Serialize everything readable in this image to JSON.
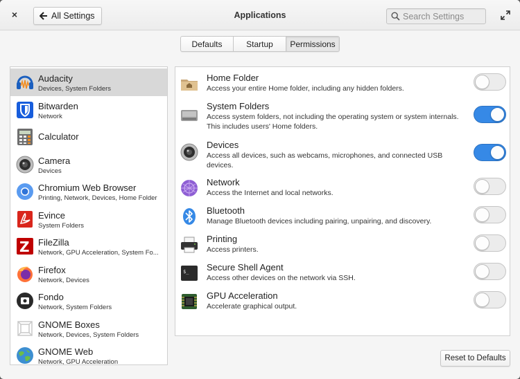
{
  "header": {
    "close_glyph": "×",
    "back_label": "All Settings",
    "title": "Applications",
    "search_placeholder": "Search Settings"
  },
  "modes": [
    {
      "label": "Defaults",
      "active": false
    },
    {
      "label": "Startup",
      "active": false
    },
    {
      "label": "Permissions",
      "active": true
    }
  ],
  "apps": [
    {
      "name": "Audacity",
      "perms": "Devices, System Folders",
      "icon": "audacity-icon",
      "selected": true
    },
    {
      "name": "Bitwarden",
      "perms": "Network",
      "icon": "bitwarden-icon"
    },
    {
      "name": "Calculator",
      "perms": "",
      "icon": "calculator-icon"
    },
    {
      "name": "Camera",
      "perms": "Devices",
      "icon": "camera-icon"
    },
    {
      "name": "Chromium Web Browser",
      "perms": "Printing, Network, Devices, Home Folder",
      "icon": "chromium-icon"
    },
    {
      "name": "Evince",
      "perms": "System Folders",
      "icon": "evince-icon"
    },
    {
      "name": "FileZilla",
      "perms": "Network, GPU Acceleration, System Fo...",
      "icon": "filezilla-icon"
    },
    {
      "name": "Firefox",
      "perms": "Network, Devices",
      "icon": "firefox-icon"
    },
    {
      "name": "Fondo",
      "perms": "Network, System Folders",
      "icon": "fondo-icon"
    },
    {
      "name": "GNOME Boxes",
      "perms": "Network, Devices, System Folders",
      "icon": "gnome-boxes-icon"
    },
    {
      "name": "GNOME Web",
      "perms": "Network, GPU Acceleration",
      "icon": "gnome-web-icon"
    }
  ],
  "permissions": [
    {
      "title": "Home Folder",
      "desc": "Access your entire Home folder, including any hidden folders.",
      "enabled": false,
      "icon": "home-folder-icon"
    },
    {
      "title": "System Folders",
      "desc": "Access system folders, not including the operating system or system internals. This includes users' Home folders.",
      "enabled": true,
      "icon": "system-folders-icon"
    },
    {
      "title": "Devices",
      "desc": "Access all devices, such as webcams, microphones, and connected USB devices.",
      "enabled": true,
      "icon": "devices-icon"
    },
    {
      "title": "Network",
      "desc": "Access the Internet and local networks.",
      "enabled": false,
      "icon": "network-icon"
    },
    {
      "title": "Bluetooth",
      "desc": "Manage Bluetooth devices including pairing, unpairing, and discovery.",
      "enabled": false,
      "icon": "bluetooth-icon"
    },
    {
      "title": "Printing",
      "desc": "Access printers.",
      "enabled": false,
      "icon": "printer-icon"
    },
    {
      "title": "Secure Shell Agent",
      "desc": "Access other devices on the network via SSH.",
      "enabled": false,
      "icon": "terminal-icon"
    },
    {
      "title": "GPU Acceleration",
      "desc": "Accelerate graphical output.",
      "enabled": false,
      "icon": "gpu-icon"
    }
  ],
  "footer": {
    "reset_label": "Reset to Defaults"
  },
  "colors": {
    "accent": "#3689e6",
    "selected_row": "#d8d8d8"
  }
}
